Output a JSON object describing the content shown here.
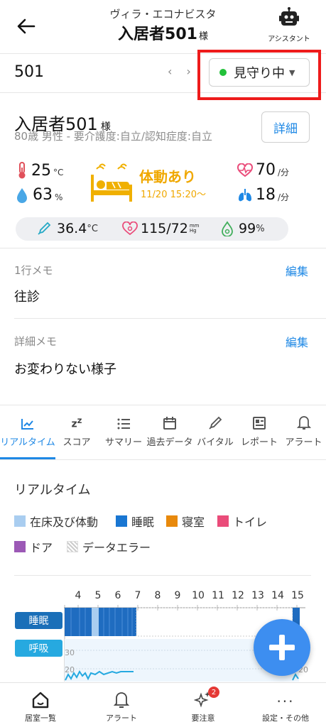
{
  "header": {
    "facility": "ヴィラ・エコナビスタ",
    "title": "入居者501",
    "title_suffix": "様",
    "assistant_label": "アシスタント"
  },
  "room": {
    "number": "501",
    "prev": "‹",
    "next": "›",
    "status": "見守り中",
    "status_color": "#22c13a"
  },
  "resident": {
    "name": "入居者501",
    "name_suffix": "様",
    "info": "80歳 男性 - 要介護度:自立/認知症度:自立",
    "detail_label": "詳細"
  },
  "environment": {
    "temperature": "25",
    "temperature_unit": "°C",
    "humidity": "63",
    "humidity_unit": "%"
  },
  "activity": {
    "status": "体動あり",
    "time": "11/20 15:20〜",
    "color": "#f0a800"
  },
  "heart": {
    "value": "70",
    "unit": "/分"
  },
  "respiration": {
    "value": "18",
    "unit": "/分"
  },
  "vitals": {
    "body_temp": "36.4",
    "body_temp_unit": "°C",
    "blood_pressure": "115/72",
    "bp_unit_top": "mm",
    "bp_unit_bottom": "Hg",
    "spo2": "99",
    "spo2_unit": "%"
  },
  "memo": {
    "one_line_label": "1行メモ",
    "one_line_text": "往診",
    "detail_label": "詳細メモ",
    "detail_text": "お変わりない様子",
    "edit_label": "編集"
  },
  "tabs": [
    {
      "label": "リアルタイム",
      "icon": "line-chart-icon",
      "active": true
    },
    {
      "label": "スコア",
      "icon": "zz-icon"
    },
    {
      "label": "サマリー",
      "icon": "list-icon"
    },
    {
      "label": "過去データ",
      "icon": "calendar-icon"
    },
    {
      "label": "バイタル",
      "icon": "pen-icon"
    },
    {
      "label": "レポート",
      "icon": "report-icon"
    },
    {
      "label": "アラート",
      "icon": "bell-icon"
    }
  ],
  "realtime": {
    "title": "リアルタイム",
    "legend": [
      {
        "label": "在床及び体動",
        "color": "#a9cdf0"
      },
      {
        "label": "睡眠",
        "color": "#1976d2"
      },
      {
        "label": "寝室",
        "color": "#e8890c"
      },
      {
        "label": "トイレ",
        "color": "#ea4c7a"
      },
      {
        "label": "ドア",
        "color": "#9c59b6"
      },
      {
        "label": "データエラー",
        "color": "hatched"
      }
    ],
    "hours": [
      "4",
      "5",
      "6",
      "7",
      "8",
      "9",
      "10",
      "11",
      "12",
      "13",
      "14",
      "15"
    ],
    "rows": [
      {
        "label": "睡眠",
        "color": "#1a6fb8"
      },
      {
        "label": "呼吸",
        "color": "#26a9e0"
      }
    ],
    "resp_ticks": [
      "30",
      "20"
    ],
    "resp_ticks_right": [
      "20"
    ]
  },
  "bottom_nav": [
    {
      "label": "居室一覧",
      "icon": "home-icon"
    },
    {
      "label": "アラート",
      "icon": "bell-icon"
    },
    {
      "label": "要注意",
      "icon": "sparkle-icon",
      "badge": "2"
    },
    {
      "label": "設定・その他",
      "icon": "more-icon"
    }
  ]
}
